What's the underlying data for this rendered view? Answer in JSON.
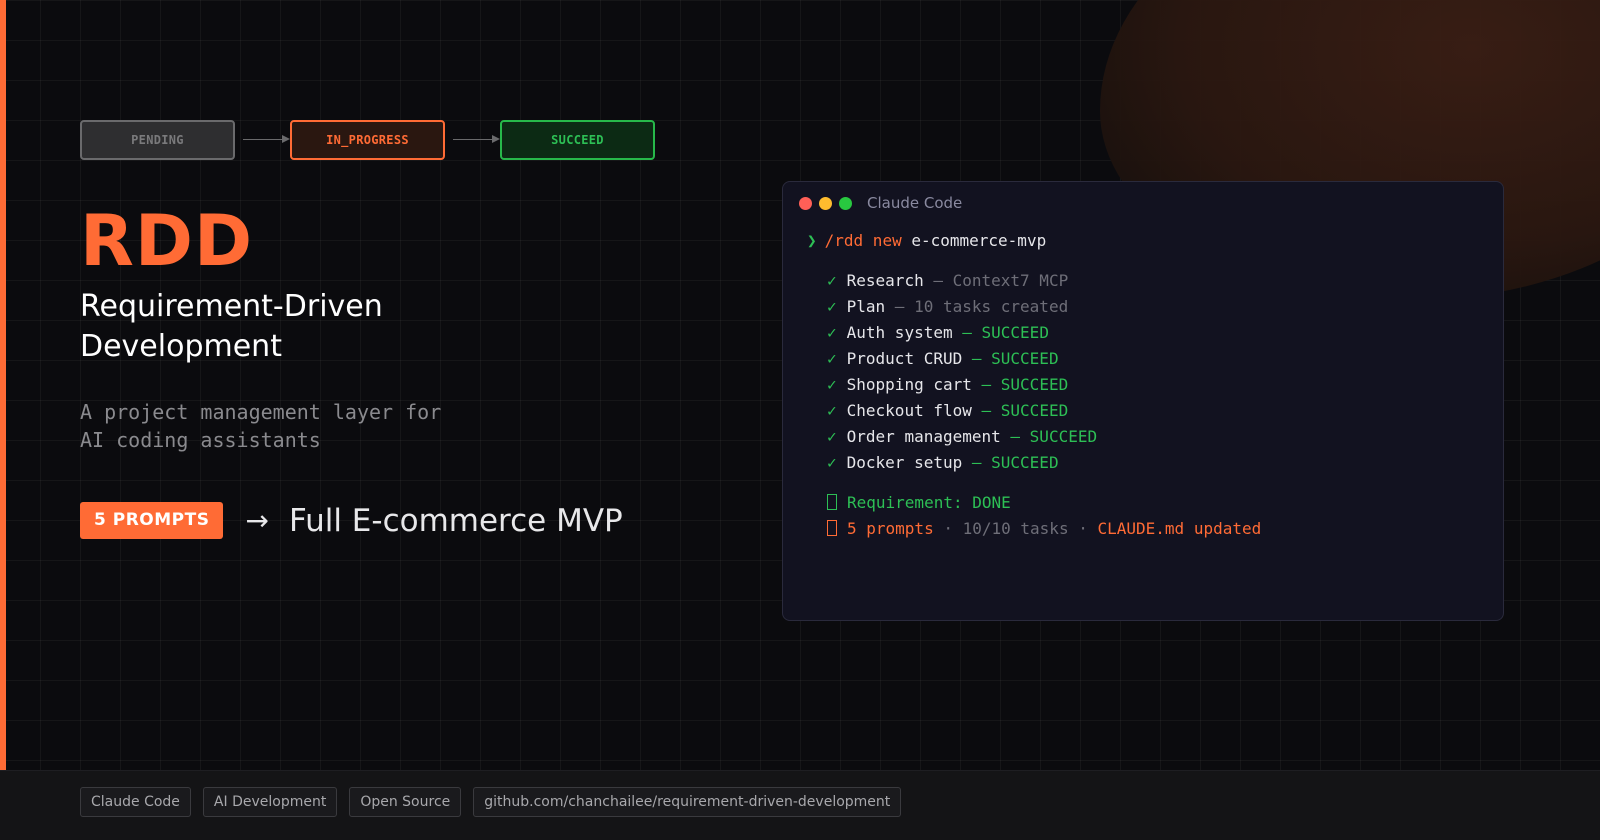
{
  "pipeline": {
    "pending": "PENDING",
    "in_progress": "IN_PROGRESS",
    "succeed": "SUCCEED"
  },
  "hero": {
    "title": "RDD",
    "subtitle_line1": "Requirement-Driven",
    "subtitle_line2": "Development",
    "desc_line1": "A project management layer for",
    "desc_line2": "AI coding assistants",
    "prompts_badge": "5 PROMPTS",
    "prompts_arrow": "→",
    "prompts_result": "Full E-commerce MVP"
  },
  "terminal": {
    "title": "Claude Code",
    "prompt_symbol": "❯",
    "command": "/rdd new",
    "argument": "e-commerce-mvp",
    "tasks": [
      {
        "check": "✓",
        "name": "Research",
        "sep": " — ",
        "detail": "Context7 MCP",
        "status": "dim"
      },
      {
        "check": "✓",
        "name": "Plan",
        "sep": " — ",
        "detail": "10 tasks created",
        "status": "dim"
      },
      {
        "check": "✓",
        "name": "Auth system",
        "sep": " — ",
        "detail": "SUCCEED",
        "status": "ok"
      },
      {
        "check": "✓",
        "name": "Product CRUD",
        "sep": " — ",
        "detail": "SUCCEED",
        "status": "ok"
      },
      {
        "check": "✓",
        "name": "Shopping cart",
        "sep": " — ",
        "detail": "SUCCEED",
        "status": "ok"
      },
      {
        "check": "✓",
        "name": "Checkout flow",
        "sep": " — ",
        "detail": "SUCCEED",
        "status": "ok"
      },
      {
        "check": "✓",
        "name": "Order management",
        "sep": " — ",
        "detail": "SUCCEED",
        "status": "ok"
      },
      {
        "check": "✓",
        "name": "Docker setup",
        "sep": " — ",
        "detail": "SUCCEED",
        "status": "ok"
      }
    ],
    "summary_done": "Requirement: DONE",
    "summary_prompts": "5 prompts",
    "summary_sep1": " · ",
    "summary_tasks": "10/10 tasks",
    "summary_sep2": " · ",
    "summary_claude": "CLAUDE.md updated"
  },
  "footer": {
    "tags": [
      "Claude Code",
      "AI Development",
      "Open Source",
      "github.com/chanchailee/requirement-driven-development"
    ]
  },
  "colors": {
    "accent": "#ff6b35",
    "success": "#2dbf55",
    "background": "#0b0b0e"
  }
}
